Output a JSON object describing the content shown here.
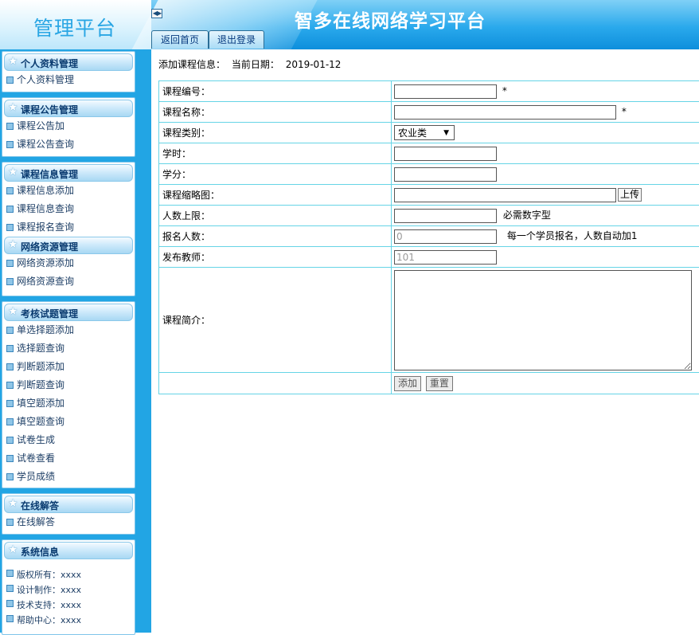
{
  "header": {
    "logo": "管理平台",
    "title": "智多在线网络学习平台",
    "toggle_icon": "collapse-toggle-icon",
    "tabs": [
      {
        "label": "返回首页"
      },
      {
        "label": "退出登录"
      }
    ]
  },
  "sidebar": {
    "groups": [
      {
        "title": "个人资料管理",
        "items": [
          "个人资料管理"
        ]
      },
      {
        "title": "课程公告管理",
        "items": [
          "课程公告加",
          "课程公告查询"
        ]
      },
      {
        "title": "课程信息管理",
        "items": [
          "课程信息添加",
          "课程信息查询",
          "课程报名查询"
        ]
      },
      {
        "title": "网络资源管理",
        "items": [
          "网络资源添加",
          "网络资源查询"
        ]
      },
      {
        "title": "考核试题管理",
        "items": [
          "单选择题添加",
          "选择题查询",
          "判断题添加",
          "判断题查询",
          "填空题添加",
          "填空题查询",
          "试卷生成",
          "试卷查看",
          "学员成绩"
        ]
      },
      {
        "title": "在线解答",
        "items": [
          "在线解答"
        ]
      },
      {
        "title": "系统信息",
        "items": [
          "版权所有：xxxx",
          "设计制作：xxxx",
          "技术支持：xxxx",
          "帮助中心：xxxx"
        ]
      }
    ]
  },
  "main": {
    "heading": "添加课程信息：",
    "date_label": "当前日期：",
    "date_value": "2019-01-12",
    "form": {
      "course_no_label": "课程编号：",
      "course_name_label": "课程名称：",
      "category_label": "课程类别：",
      "category_value": "农业类",
      "hours_label": "学时：",
      "credits_label": "学分：",
      "thumbnail_label": "课程缩略图：",
      "upload_label": "上传",
      "limit_label": "人数上限：",
      "limit_hint": "必需数字型",
      "enrolled_label": "报名人数：",
      "enrolled_value": "0",
      "enrolled_hint": "每一个学员报名，人数自动加1",
      "teacher_label": "发布教师：",
      "teacher_value": "101",
      "intro_label": "课程简介：",
      "required_mark": "*",
      "add_button": "添加",
      "reset_button": "重置"
    }
  },
  "colors": {
    "header_blue": "#2aa9ec",
    "sidebar_blue": "#22a5e4",
    "table_border": "#66d4e6",
    "menu_text": "#1e3f66"
  }
}
